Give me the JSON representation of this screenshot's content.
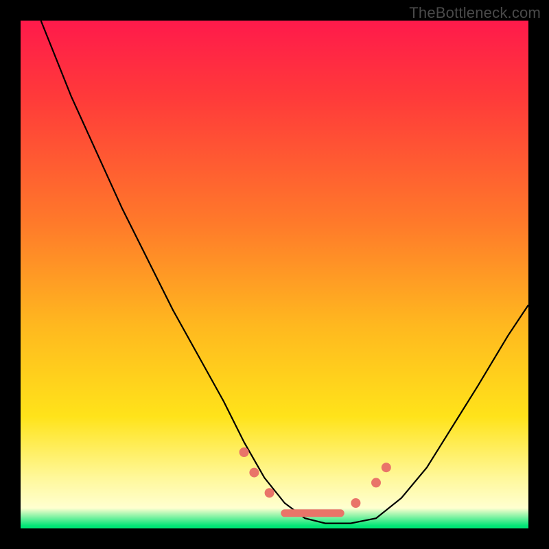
{
  "watermark": "TheBottleneck.com",
  "chart_data": {
    "type": "line",
    "title": "",
    "xlabel": "",
    "ylabel": "",
    "xlim": [
      0,
      100
    ],
    "ylim": [
      0,
      100
    ],
    "grid": false,
    "legend": false,
    "series": [
      {
        "name": "bottleneck-curve",
        "x": [
          4,
          10,
          15,
          20,
          25,
          30,
          35,
          40,
          44,
          48,
          52,
          56,
          60,
          65,
          70,
          75,
          80,
          85,
          90,
          96,
          100
        ],
        "y": [
          100,
          85,
          74,
          63,
          53,
          43,
          34,
          25,
          17,
          10,
          5,
          2,
          1,
          1,
          2,
          6,
          12,
          20,
          28,
          38,
          44
        ]
      }
    ],
    "markers": [
      {
        "name": "left-dot-1",
        "x": 44,
        "y": 15
      },
      {
        "name": "left-dot-2",
        "x": 46,
        "y": 11
      },
      {
        "name": "left-dot-3",
        "x": 49,
        "y": 7
      },
      {
        "name": "flat-segment",
        "x0": 52,
        "x1": 63,
        "y": 3
      },
      {
        "name": "right-dot-1",
        "x": 66,
        "y": 5
      },
      {
        "name": "right-dot-2",
        "x": 70,
        "y": 9
      },
      {
        "name": "right-dot-3",
        "x": 72,
        "y": 12
      }
    ],
    "colors": {
      "curve": "#000000",
      "marker": "#e97469",
      "gradient_top": "#ff1a4b",
      "gradient_mid": "#ffe31a",
      "gradient_bottom": "#00e676",
      "frame": "#000000"
    }
  }
}
